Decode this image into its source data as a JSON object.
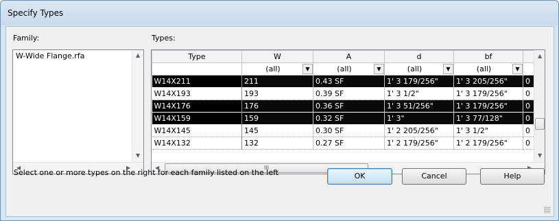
{
  "window": {
    "title": "Specify Types"
  },
  "family": {
    "label": "Family:",
    "items": [
      "W-Wide Flange.rfa"
    ]
  },
  "types": {
    "label": "Types:",
    "columns": [
      "Type",
      "W",
      "A",
      "d",
      "bf"
    ],
    "filters": [
      "(all)",
      "(all)",
      "(all)",
      "(all)"
    ],
    "rows": [
      {
        "type": "W14X211",
        "W": "211",
        "A": "0.43 SF",
        "d": "1'  3 179/256\"",
        "bf": "1'  3 205/256\"",
        "extra": "0",
        "selected": true
      },
      {
        "type": "W14X193",
        "W": "193",
        "A": "0.39 SF",
        "d": "1'  3 1/2\"",
        "bf": "1'  3 179/256\"",
        "extra": "0",
        "selected": false
      },
      {
        "type": "W14X176",
        "W": "176",
        "A": "0.36 SF",
        "d": "1'  3 51/256\"",
        "bf": "1'  3 179/256\"",
        "extra": "0",
        "selected": true
      },
      {
        "type": "W14X159",
        "W": "159",
        "A": "0.32 SF",
        "d": "1'  3\"",
        "bf": "1'  3 77/128\"",
        "extra": "0",
        "selected": true
      },
      {
        "type": "W14X145",
        "W": "145",
        "A": "0.30 SF",
        "d": "1'  2 205/256\"",
        "bf": "1'  3 1/2\"",
        "extra": "0",
        "selected": false
      },
      {
        "type": "W14X132",
        "W": "132",
        "A": "0.27 SF",
        "d": "1'  2 179/256\"",
        "bf": "1'  2 179/256\"",
        "extra": "0",
        "selected": false
      }
    ]
  },
  "hint": "Select one or more types on the right for each family listed on the left",
  "buttons": {
    "ok": "OK",
    "cancel": "Cancel",
    "help": "Help"
  },
  "icons": {
    "arrow_up": "▲",
    "arrow_down": "▼",
    "arrow_left": "◀",
    "arrow_right": "▶",
    "dropdown": "▼",
    "grip": "resize-grip"
  },
  "scroll_thumb_glyph": "III"
}
